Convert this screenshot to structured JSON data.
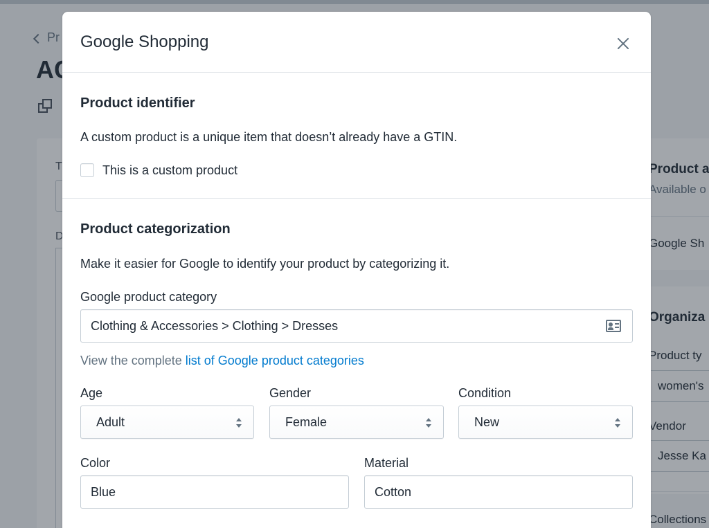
{
  "background": {
    "back_label": "Pr",
    "title": "AC",
    "left_letter_1": "T",
    "left_letter_2": "D",
    "right": {
      "card1_title": "Product a",
      "card1_sub": "Available o",
      "card1_item": "Google Sh",
      "card2_title": "Organiza",
      "product_type_label": "Product ty",
      "product_type_value": "women's",
      "vendor_label": "Vendor",
      "vendor_value": "Jesse Ka",
      "collections_label": "Collections"
    }
  },
  "modal": {
    "title": "Google Shopping",
    "identifier": {
      "heading": "Product identifier",
      "description": "A custom product is a unique item that doesn’t already have a GTIN.",
      "checkbox_label": "This is a custom product"
    },
    "categorization": {
      "heading": "Product categorization",
      "description": "Make it easier for Google to identify your product by categorizing it.",
      "category_label": "Google product category",
      "category_value": "Clothing & Accessories > Clothing > Dresses",
      "helper_prefix": "View the complete ",
      "helper_link": "list of Google product categories",
      "age_label": "Age",
      "age_value": "Adult",
      "gender_label": "Gender",
      "gender_value": "Female",
      "condition_label": "Condition",
      "condition_value": "New",
      "color_label": "Color",
      "color_value": "Blue",
      "material_label": "Material",
      "material_value": "Cotton"
    }
  },
  "colors": {
    "link": "#007ace",
    "text": "#212b36",
    "muted": "#637381",
    "border": "#c4cdd5"
  }
}
